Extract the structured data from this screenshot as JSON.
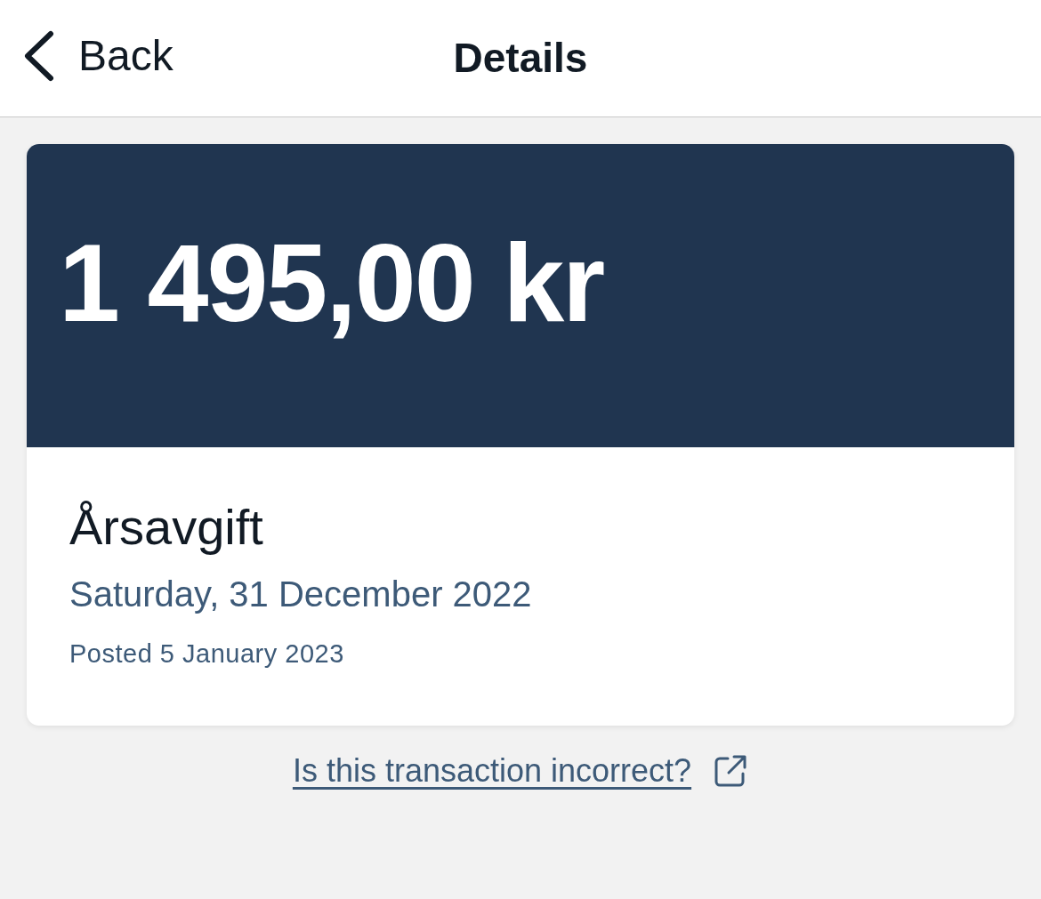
{
  "header": {
    "back_label": "Back",
    "title": "Details"
  },
  "transaction": {
    "amount": "1 495,00 kr",
    "description": "Årsavgift",
    "date": "Saturday, 31 December 2022",
    "posted": "Posted 5 January 2023"
  },
  "report_link": "Is this transaction incorrect?"
}
